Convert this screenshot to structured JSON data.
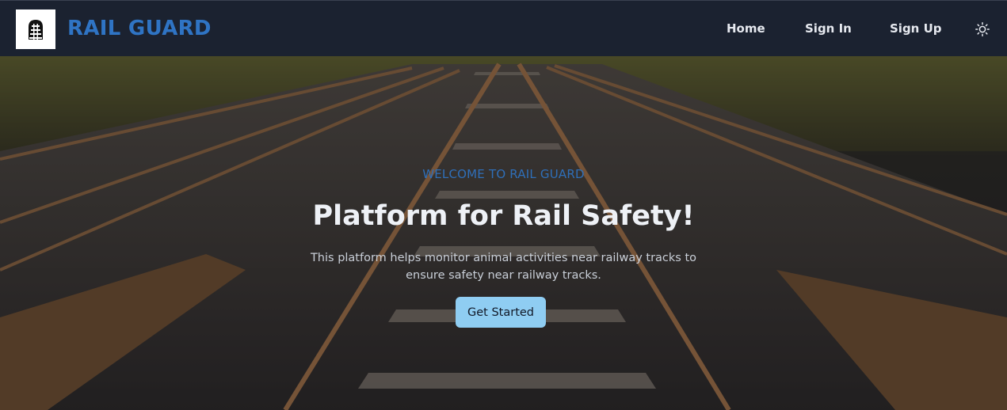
{
  "nav": {
    "brand": "RAIL GUARD",
    "logo_icon": "train-track-icon",
    "links": [
      {
        "label": "Home"
      },
      {
        "label": "Sign In"
      },
      {
        "label": "Sign Up"
      }
    ],
    "theme_icon": "sun-icon"
  },
  "hero": {
    "eyebrow": "WELCOME TO RAIL GUARD",
    "title": "Platform for Rail Safety!",
    "description": "This platform helps monitor animal activities near railway tracks to ensure safety near railway tracks.",
    "cta_label": "Get Started",
    "background_image": "railway-tracks"
  },
  "colors": {
    "navbar_bg": "#1b2230",
    "brand": "#2f74c4",
    "eyebrow": "#2f6fb8",
    "cta_bg": "#8fcdf2"
  }
}
